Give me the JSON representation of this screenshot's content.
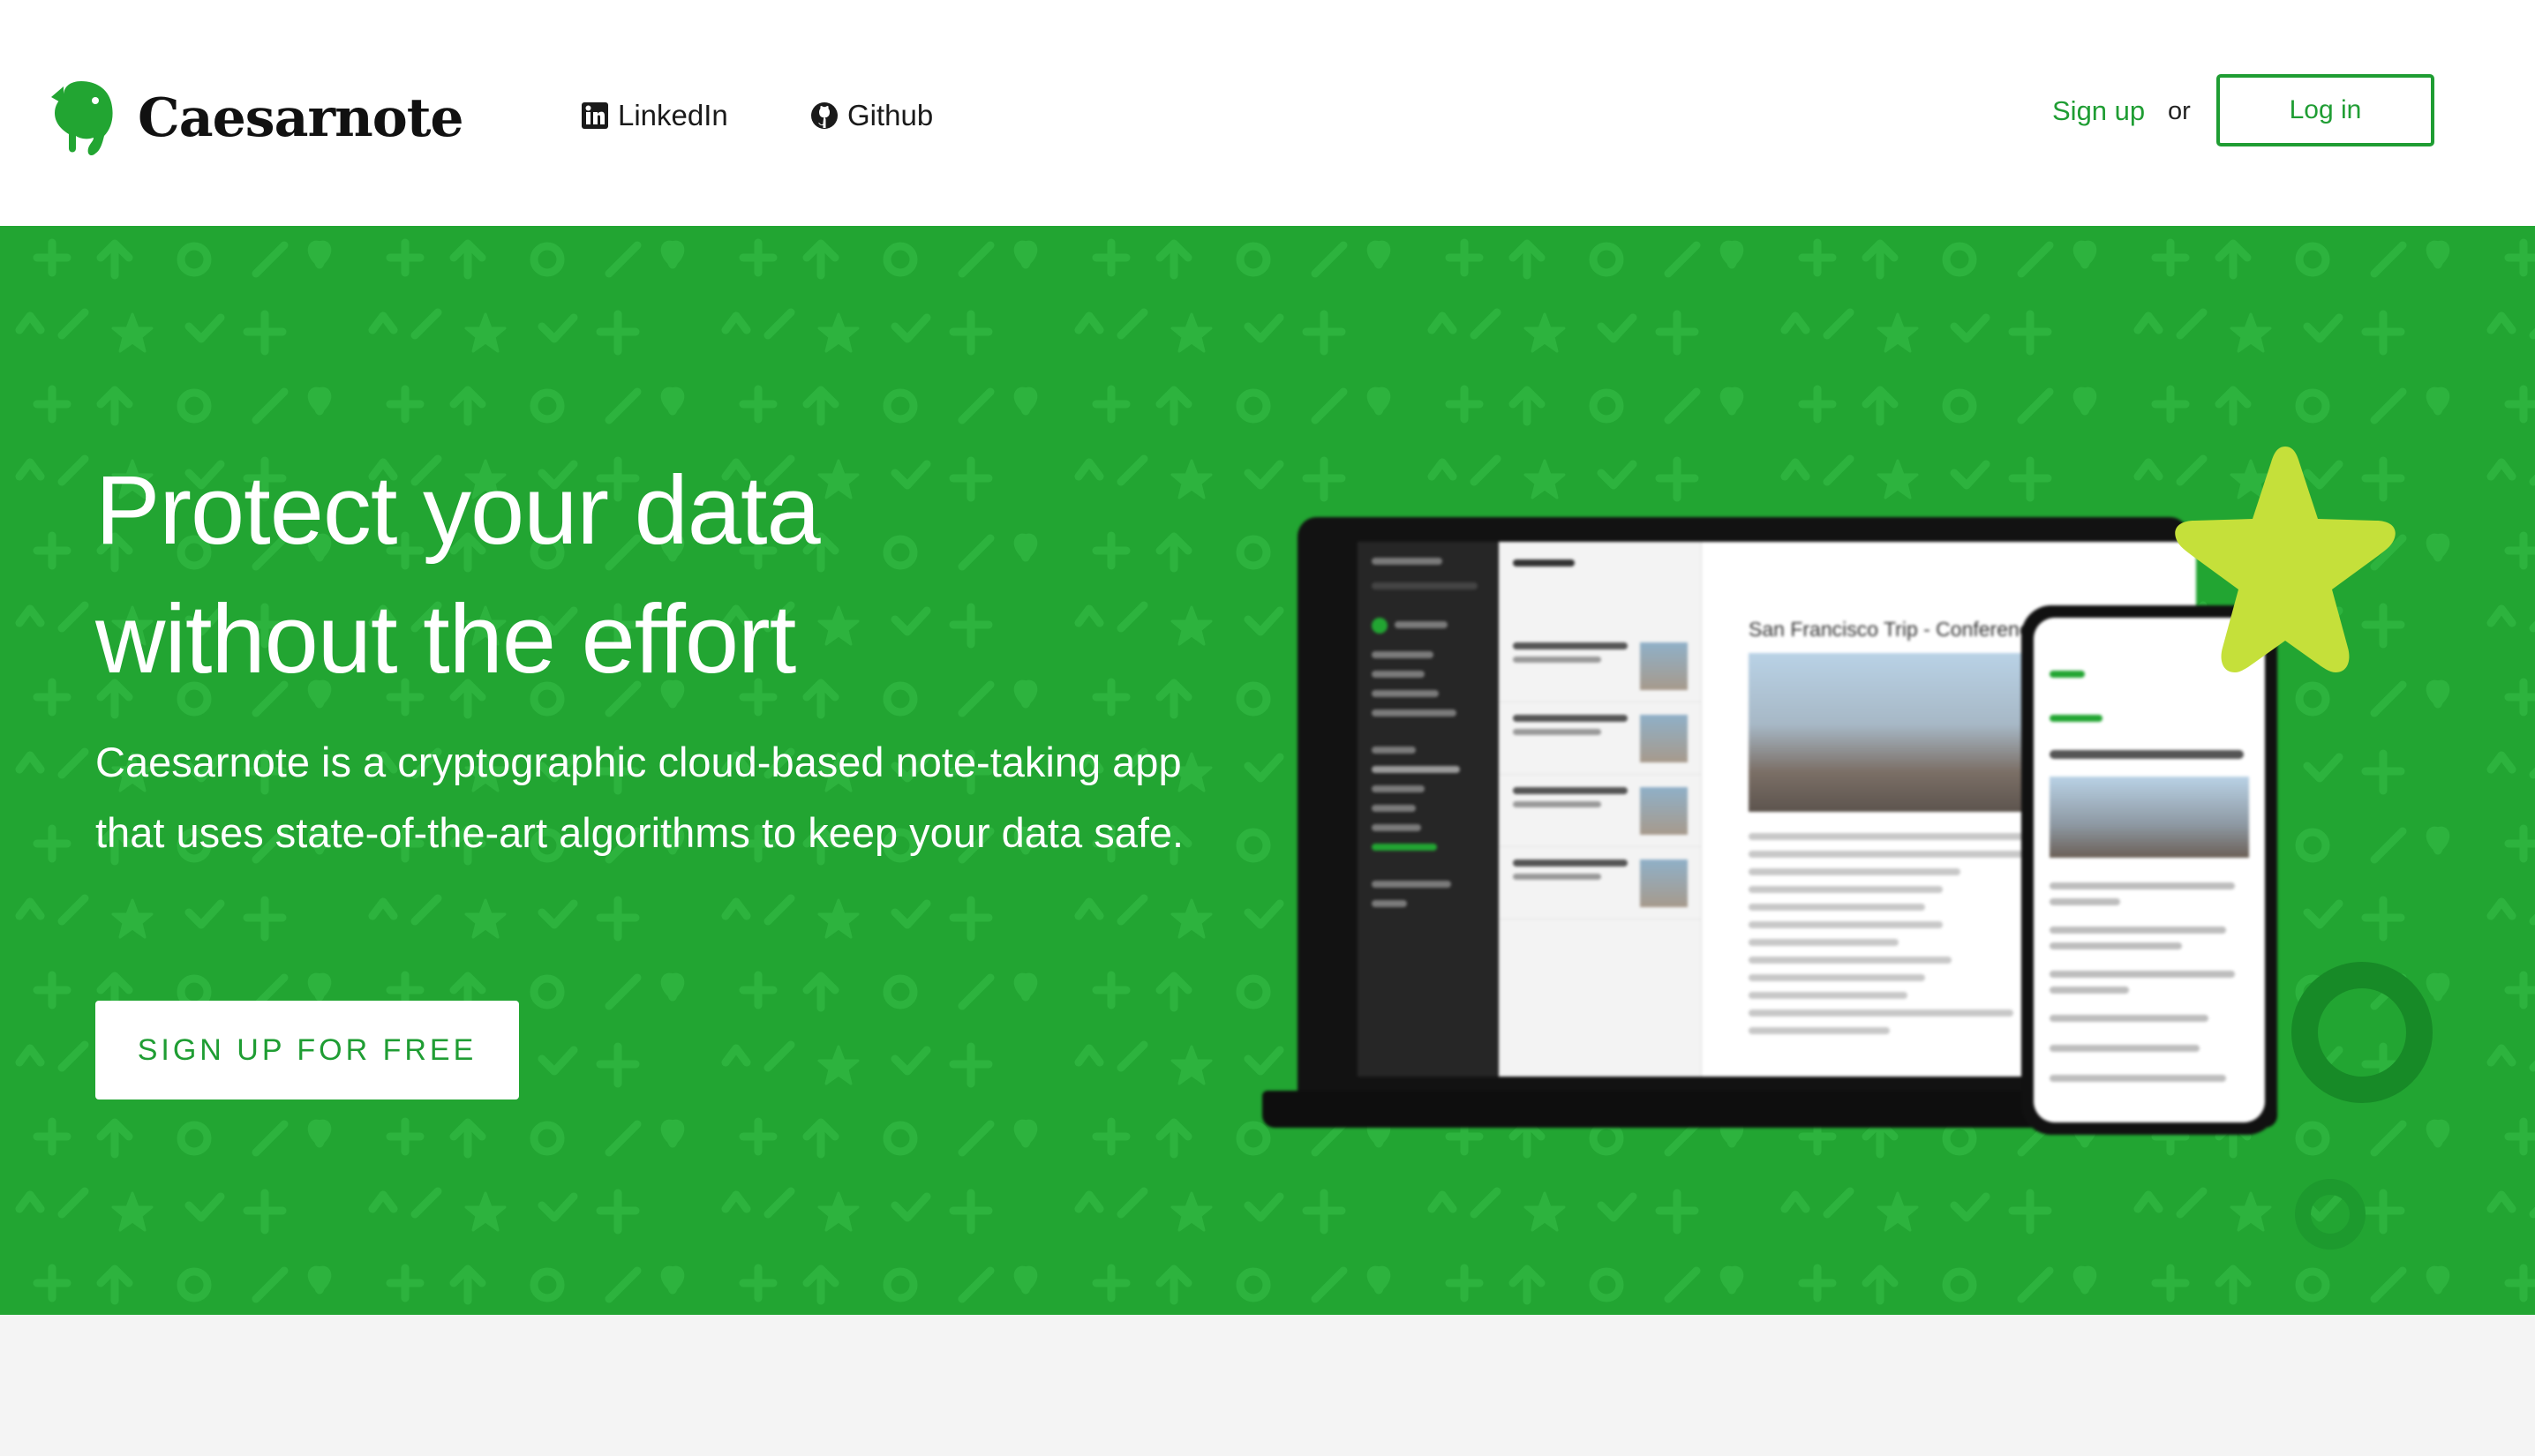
{
  "brand": {
    "name": "Caesarnote",
    "accent_color": "#1f9d33",
    "logo_icon": "elephant-icon"
  },
  "nav": {
    "links": [
      {
        "label": "LinkedIn",
        "icon": "linkedin-icon"
      },
      {
        "label": "Github",
        "icon": "github-icon"
      }
    ],
    "signup_label": "Sign up",
    "or_label": "or",
    "login_label": "Log in"
  },
  "hero": {
    "background_color": "#22a532",
    "headline_line1": "Protect your data",
    "headline_line2": "without the effort",
    "subcopy": "Caesarnote is a cryptographic cloud-based note-taking app that uses state-of-the-art algorithms to keep your data safe.",
    "cta_label": "SIGN UP FOR FREE"
  },
  "mockup": {
    "note_title": "San Francisco Trip - Conference"
  }
}
